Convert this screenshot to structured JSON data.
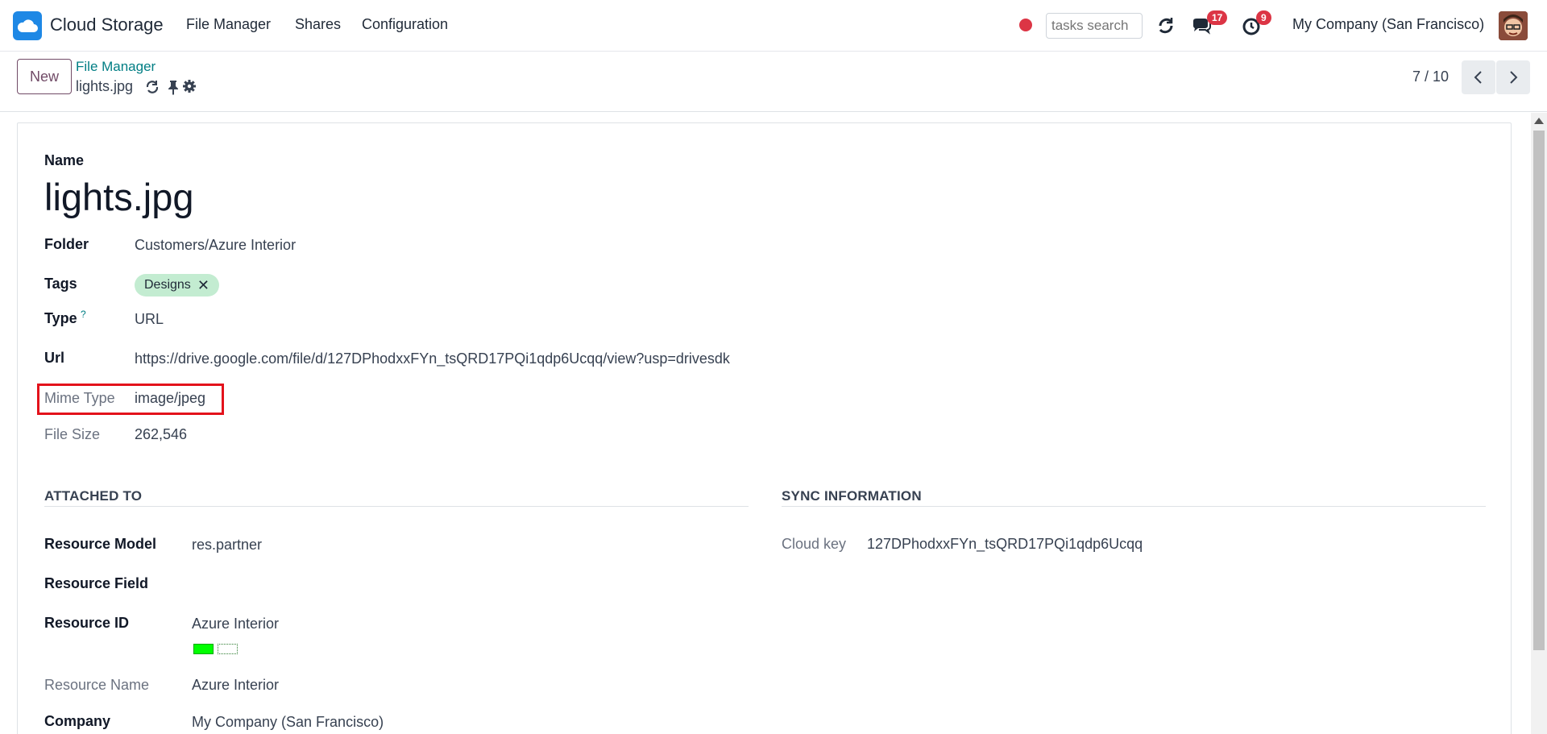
{
  "navbar": {
    "app_name": "Cloud Storage",
    "menus": [
      "File Manager",
      "Shares",
      "Configuration"
    ],
    "search_placeholder": "tasks search",
    "messages_count": "17",
    "activities_count": "9",
    "company": "My Company (San Francisco)"
  },
  "control_panel": {
    "new_label": "New",
    "breadcrumb_parent": "File Manager",
    "breadcrumb_current": "lights.jpg",
    "pager": "7 / 10"
  },
  "form": {
    "name_label": "Name",
    "name_value": "lights.jpg",
    "folder_label": "Folder",
    "folder_value": "Customers/Azure Interior",
    "tags_label": "Tags",
    "tag_value": "Designs",
    "type_label": "Type",
    "type_help": "?",
    "type_value": "URL",
    "url_label": "Url",
    "url_value": "https://drive.google.com/file/d/127DPhodxxFYn_tsQRD17PQi1qdp6Ucqq/view?usp=drivesdk",
    "mime_label": "Mime Type",
    "mime_value": "image/jpeg",
    "filesize_label": "File Size",
    "filesize_value": "262,546"
  },
  "attached_to": {
    "title": "ATTACHED TO",
    "resource_model_label": "Resource Model",
    "resource_model_value": "res.partner",
    "resource_field_label": "Resource Field",
    "resource_id_label": "Resource ID",
    "resource_id_value": "Azure Interior",
    "resource_name_label": "Resource Name",
    "resource_name_value": "Azure Interior",
    "company_label": "Company",
    "company_value": "My Company (San Francisco)"
  },
  "sync_information": {
    "title": "SYNC INFORMATION",
    "cloud_key_label": "Cloud key",
    "cloud_key_value": "127DPhodxxFYn_tsQRD17PQi1qdp6Ucqq"
  },
  "colors": {
    "accent": "#714b67",
    "link": "#017e84",
    "tag_bg": "#c3ecd1",
    "badge": "#dc3545",
    "highlight": "#e3121b"
  }
}
